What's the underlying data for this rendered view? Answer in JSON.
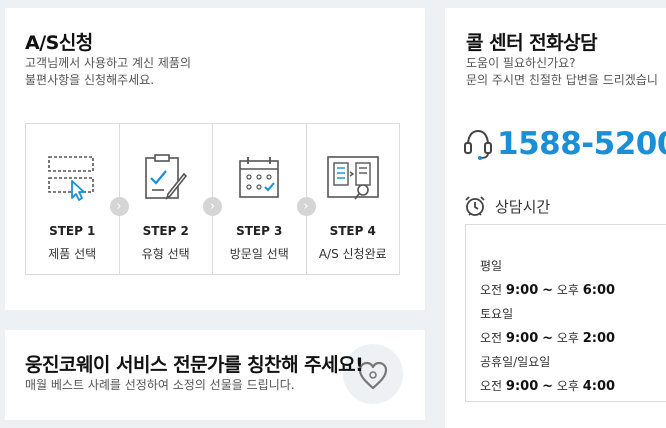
{
  "as": {
    "title": "A/S신청",
    "desc_line1": "고객님께서 사용하고 계신 제품의",
    "desc_line2": "불편사항을 신청해주세요.",
    "steps": [
      {
        "num": "STEP 1",
        "label": "제품 선택",
        "icon": "product-select-icon"
      },
      {
        "num": "STEP 2",
        "label": "유형 선택",
        "icon": "clipboard-check-icon"
      },
      {
        "num": "STEP 3",
        "label": "방문일 선택",
        "icon": "calendar-icon"
      },
      {
        "num": "STEP 4",
        "label": "A/S 신청완료",
        "icon": "document-search-icon"
      }
    ]
  },
  "praise": {
    "title": "웅진코웨이 서비스 전문가를 칭찬해 주세요!",
    "desc": "매월 베스트 사례를 선정하여 소정의 선물을 드립니다."
  },
  "call": {
    "title": "콜 센터 전화상담",
    "desc_line1": "도움이 필요하신가요?",
    "desc_line2": "문의 주시면 친절한 답변을 드리겠습니",
    "phone": "1588-5200",
    "hours_label": "상담시간",
    "hours": [
      {
        "day": "평일",
        "am": "오전",
        "start": "9:00",
        "tilde": "~",
        "pm": "오후",
        "end": "6:00"
      },
      {
        "day": "토요일",
        "am": "오전",
        "start": "9:00",
        "tilde": "~",
        "pm": "오후",
        "end": "2:00"
      },
      {
        "day": "공휴일/일요일",
        "am": "오전",
        "start": "9:00",
        "tilde": "~",
        "pm": "오후",
        "end": "4:00"
      }
    ]
  },
  "colors": {
    "accent": "#1a8fd6",
    "background": "#eef1f4"
  }
}
